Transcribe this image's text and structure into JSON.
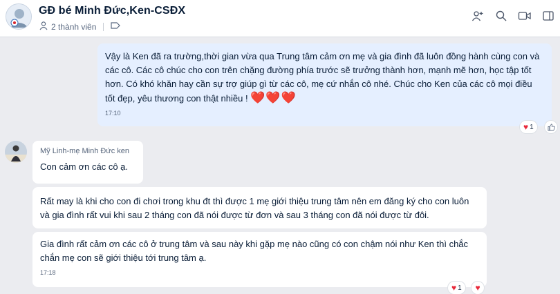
{
  "header": {
    "title": "GĐ bé Minh Đức,Ken-CSĐX",
    "member_count": "2 thành viên",
    "icons": [
      "add-member-icon",
      "search-icon",
      "video-call-icon",
      "sidebar-toggle-icon"
    ]
  },
  "messages": {
    "outgoing": {
      "text": "Vậy là Ken đã ra trường,thời gian vừa qua Trung tâm cảm ơn mẹ và gia đình đã luôn đồng hành cùng con và các cô. Các cô chúc cho con trên chặng đường phía trước sẽ trưởng thành hơn, mạnh mẽ hơn, học tập tốt hơn. Có khó khăn hay cần sự trợ giúp gì từ các cô, mẹ cứ nhắn cô nhé. Chúc cho Ken của các cô mọi điều tốt đẹp, yêu thương con thật nhiều !",
      "emoji": "❤️❤️❤️",
      "time": "17:10",
      "reaction_count": "1"
    },
    "incoming": {
      "sender": "Mỹ Linh-mẹ Minh Đức ken",
      "items": [
        {
          "text": "Con cảm ơn các cô ạ."
        },
        {
          "text": "Rất may là khi cho con đi chơi trong khu đt thì được 1 mẹ giới thiệu trung tâm nên em đăng ký cho con luôn và gia đình rất vui khi sau 2 tháng con đã nói được từ đơn và sau 3 tháng con đã nói được từ đôi."
        },
        {
          "text": "Gia đình rất cảm ơn các cô ở trung tâm và sau này khi gặp mẹ nào cũng có con chậm nói như Ken thì chắc chắn mẹ con sẽ giới thiệu tới trung tâm ạ.",
          "time": "17:18"
        }
      ],
      "reaction_count": "1"
    }
  },
  "colors": {
    "background": "#ebecf0",
    "outgoing_bubble": "#e5efff",
    "incoming_bubble": "#ffffff",
    "heart": "#e8283a"
  }
}
